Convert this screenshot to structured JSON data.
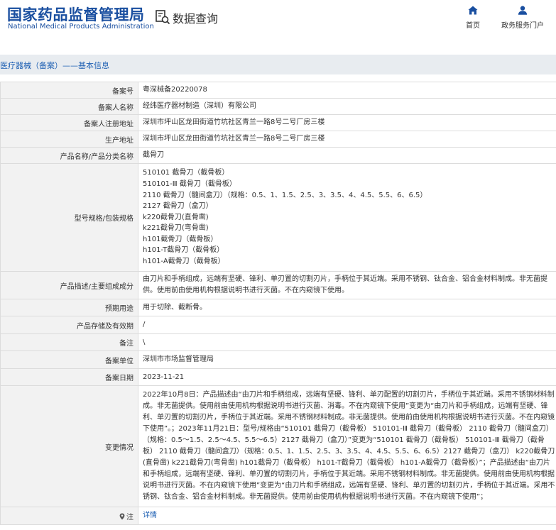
{
  "header": {
    "logo_cn": "国家药品监督管理局",
    "logo_en": "National Medical Products Administration",
    "query_title": "数据查询",
    "nav": [
      {
        "label": "首页",
        "icon": "home-icon"
      },
      {
        "label": "政务服务门户",
        "icon": "user-icon"
      }
    ]
  },
  "breadcrumb": "医疗器械（备案）——基本信息",
  "colors": {
    "brand": "#1a4fa0",
    "link": "#1d5fb3",
    "label_bg": "#f2f2f2",
    "bar_bg": "#e8ecf0"
  },
  "fields": {
    "filing_no": {
      "label": "备案号",
      "value": "粤深械备20220078"
    },
    "filer_name": {
      "label": "备案人名称",
      "value": "经纬医疗器材制造（深圳）有限公司"
    },
    "filer_address": {
      "label": "备案人注册地址",
      "value": "深圳市坪山区龙田街道竹坑社区青兰一路8号二号厂房三楼"
    },
    "production_address": {
      "label": "生产地址",
      "value": "深圳市坪山区龙田街道竹坑社区青兰一路8号二号厂房三楼"
    },
    "product_name": {
      "label": "产品名称/产品分类名称",
      "value": "截骨刀"
    },
    "models": {
      "label": "型号规格/包装规格",
      "lines": [
        "510101 截骨刀（截骨板）",
        "510101-Ⅲ 截骨刀（截骨板）",
        "2110 截骨刀（髓间盒刀）（规格：0.5、1、1.5、2.5、3、3.5、4、4.5、5.5、6、6.5）",
        "2127 截骨刀（盒刀）",
        "k220截骨刀(直骨凿)",
        "k221截骨刀(弯骨凿)",
        "h101截骨刀（截骨板）",
        "h101-T截骨刀（截骨板）",
        "h101-A截骨刀（截骨板）"
      ]
    },
    "description": {
      "label": "产品描述/主要组成成分",
      "value": "由刀片和手柄组成，远端有坚硬、锋利、单刃置的切割刃片，手柄位于其近端。采用不锈钢、钛合金、铝合金材料制成。非无菌提供。使用前由使用机构根据说明书进行灭菌。不在内窥镜下使用。"
    },
    "intended_use": {
      "label": "预期用途",
      "value": "用于切除、截断骨。"
    },
    "storage": {
      "label": "产品存储及有效期",
      "value": "/"
    },
    "remark": {
      "label": "备注",
      "value": "\\"
    },
    "filing_unit": {
      "label": "备案单位",
      "value": "深圳市市场监督管理局"
    },
    "filing_date": {
      "label": "备案日期",
      "value": "2023-11-21"
    },
    "changes": {
      "label": "变更情况",
      "value": "2022年10月8日：产品描述由“由刀片和手柄组成，远端有坚硬、锋利、单刃配置的切割刃片，手柄位于其近端。采用不锈钢材料制成。非无菌提供。使用前由使用机构根据说明书进行灭菌、消毒。不在内窥镜下使用”变更为“由刀片和手柄组成，远端有坚硬、锋利、单刃置的切割刃片，手柄位于其近端。采用不锈钢材料制成。非无菌提供。使用前由使用机构根据说明书进行灭菌。不在内窥镜下使用”。；2023年11月21日：型号/规格由“510101 截骨刀（截骨板） 510101-Ⅲ 截骨刀（截骨板） 2110 截骨刀（髓间盒刀）（规格：0.5～1.5、2.5～4.5、5.5～6.5）2127 截骨刀（盒刀）”变更为“510101 截骨刀（截骨板） 510101-Ⅲ 截骨刀（截骨板） 2110 截骨刀（髓间盒刀）（规格：0.5、1、1.5、2.5、3、3.5、4、4.5、5.5、6、6.5）2127 截骨刀（盒刀） k220截骨刀(直骨凿) k221截骨刀(弯骨凿) h101截骨刀（截骨板） h101-T截骨刀（截骨板） h101-A截骨刀（截骨板）”；产品描述由“由刀片和手柄组成，远端有坚硬、锋利、单刃置的切割刃片，手柄位于其近端。采用不锈钢材料制成。非无菌提供。使用前由使用机构根据说明书进行灭菌。不在内窥镜下使用”变更为“由刀片和手柄组成，远端有坚硬、锋利、单刃置的切割刃片，手柄位于其近端。采用不锈钢、钛合金、铝合金材料制成。非无菌提供。使用前由使用机构根据说明书进行灭菌。不在内窥镜下使用”；"
    },
    "note": {
      "label": "注",
      "value": "详情",
      "icon": "pin-icon"
    }
  }
}
